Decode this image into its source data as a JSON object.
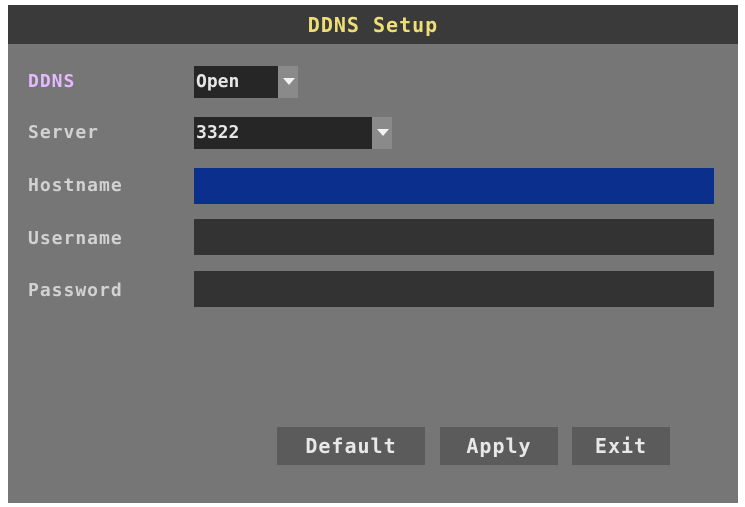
{
  "window": {
    "title": "DDNS Setup"
  },
  "form": {
    "ddns": {
      "label": "DDNS",
      "value": "Open"
    },
    "server": {
      "label": "Server",
      "value": "3322"
    },
    "hostname": {
      "label": "Hostname",
      "value": ""
    },
    "username": {
      "label": "Username",
      "value": ""
    },
    "password": {
      "label": "Password",
      "value": ""
    }
  },
  "buttons": {
    "default_label": "Default",
    "apply_label": "Apply",
    "exit_label": "Exit"
  },
  "colors": {
    "title_text": "#eddf76",
    "active_label": "#e4b9ff",
    "focused_field": "#0b2f8c",
    "panel_background": "#767676"
  }
}
